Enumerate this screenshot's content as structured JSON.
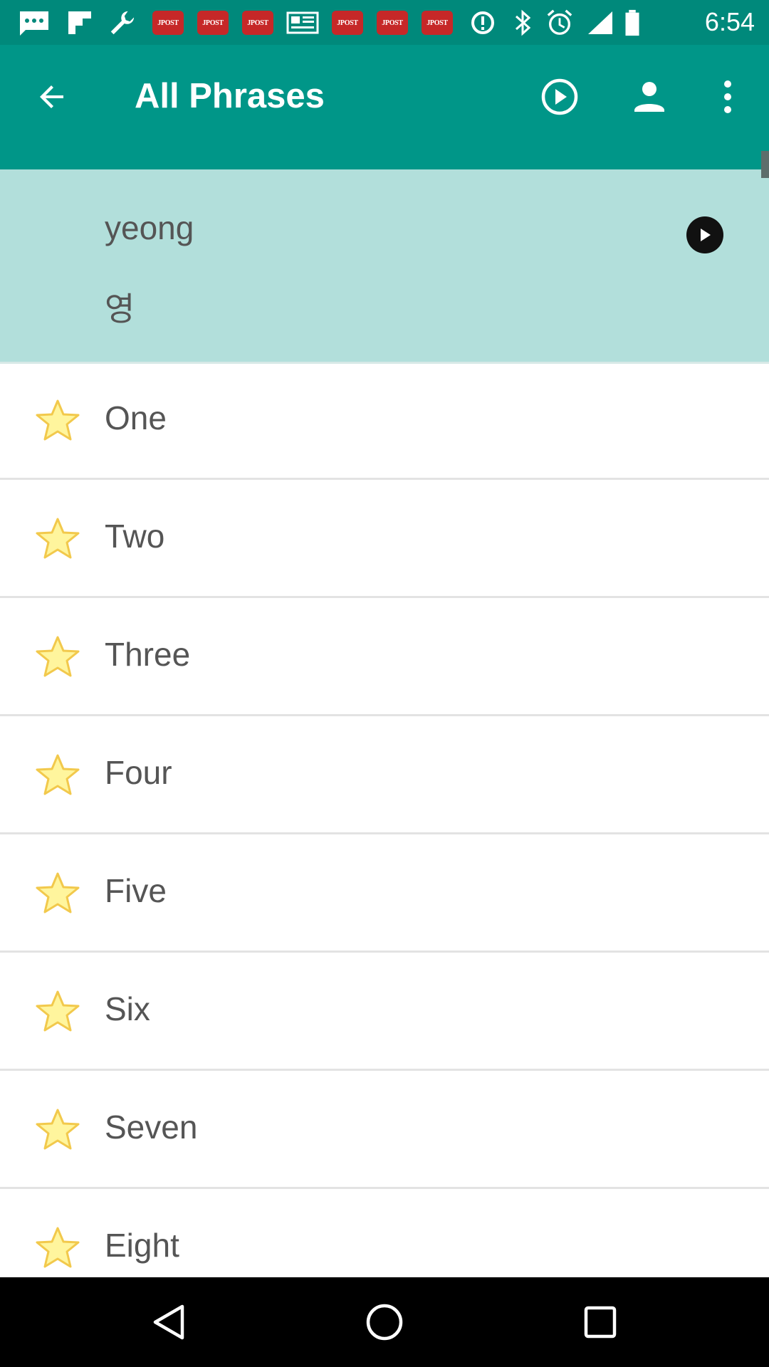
{
  "status_bar": {
    "time": "6:54",
    "notification_label": "JPOST",
    "icons": [
      "messages-icon",
      "flipboard-icon",
      "wrench-icon",
      "news-icon",
      "data-saver-icon",
      "bluetooth-icon",
      "alarm-icon",
      "signal-icon",
      "battery-icon"
    ]
  },
  "toolbar": {
    "title": "All Phrases",
    "icons": [
      "back-arrow-icon",
      "play-circle-icon",
      "account-icon",
      "more-vert-icon"
    ]
  },
  "header_card": {
    "romanization": "yeong",
    "native": "영"
  },
  "phrases": [
    {
      "label": "One"
    },
    {
      "label": "Two"
    },
    {
      "label": "Three"
    },
    {
      "label": "Four"
    },
    {
      "label": "Five"
    },
    {
      "label": "Six"
    },
    {
      "label": "Seven"
    },
    {
      "label": "Eight"
    }
  ],
  "colors": {
    "primary": "#009688",
    "primary_dark": "#00897b",
    "header_bg": "#b2dfdb",
    "star_fill": "#fff59d",
    "star_stroke": "#f2c94c"
  },
  "nav_bar": {
    "icons": [
      "back-triangle-icon",
      "home-circle-icon",
      "recents-square-icon"
    ]
  }
}
